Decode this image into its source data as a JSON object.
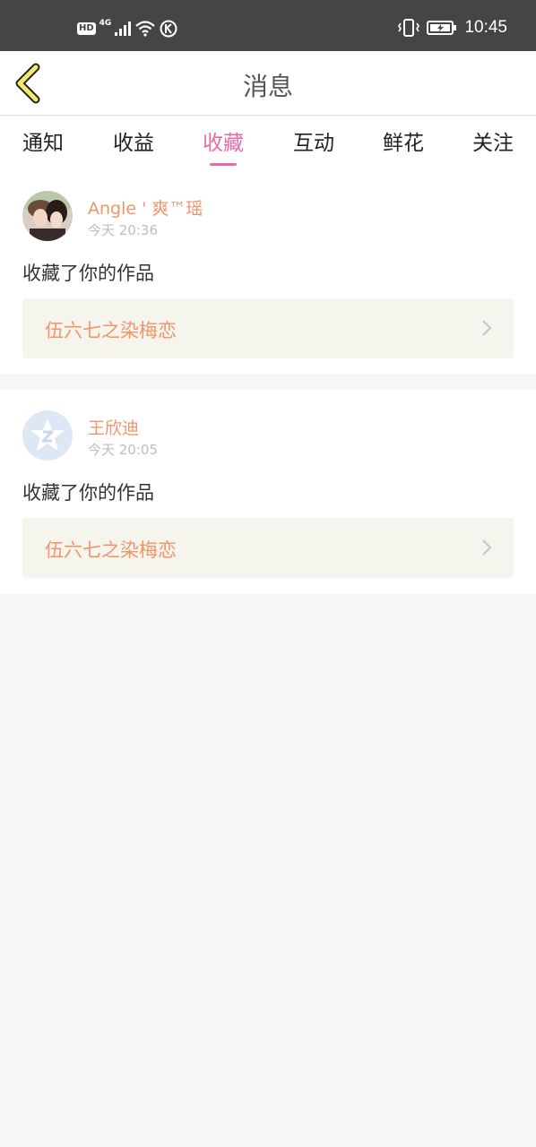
{
  "statusbar": {
    "hd": "HD",
    "network": "4G",
    "time": "10:45"
  },
  "header": {
    "title": "消息",
    "back_icon": "chevron-left-icon",
    "back_color": "#f2e96b"
  },
  "tabs": [
    {
      "label": "通知"
    },
    {
      "label": "收益"
    },
    {
      "label": "收藏",
      "active": true
    },
    {
      "label": "互动"
    },
    {
      "label": "鲜花"
    },
    {
      "label": "关注"
    }
  ],
  "accent_color": "#e86aa6",
  "name_color": "#f0956a",
  "messages": [
    {
      "user": "Angle ' 爽™瑶",
      "time": "今天 20:36",
      "action": "收藏了你的作品",
      "work": "伍六七之染梅恋",
      "avatar": "photo-avatar"
    },
    {
      "user": "王欣迪",
      "time": "今天 20:05",
      "action": "收藏了你的作品",
      "work": "伍六七之染梅恋",
      "avatar": "qq-star-avatar"
    }
  ]
}
